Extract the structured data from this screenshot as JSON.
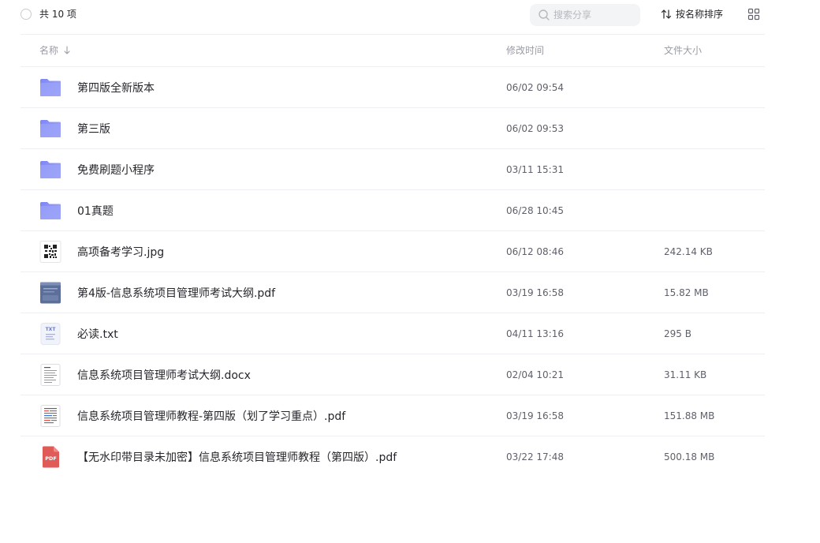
{
  "toolbar": {
    "total_label": "共 10 项",
    "search_placeholder": "搜索分享",
    "sort_label": "按名称排序"
  },
  "header": {
    "name": "名称",
    "modified": "修改时间",
    "size": "文件大小"
  },
  "files": [
    {
      "name": "第四版全新版本",
      "modified": "06/02 09:54",
      "size": "",
      "icon": "folder-icon"
    },
    {
      "name": "第三版",
      "modified": "06/02 09:53",
      "size": "",
      "icon": "folder-icon"
    },
    {
      "name": "免费刷题小程序",
      "modified": "03/11 15:31",
      "size": "",
      "icon": "folder-icon"
    },
    {
      "name": "01真题",
      "modified": "06/28 10:45",
      "size": "",
      "icon": "folder-icon"
    },
    {
      "name": "高项备考学习.jpg",
      "modified": "06/12 08:46",
      "size": "242.14 KB",
      "icon": "qr-image-thumbnail-icon"
    },
    {
      "name": "第4版-信息系统项目管理师考试大纲.pdf",
      "modified": "03/19 16:58",
      "size": "15.82 MB",
      "icon": "pdf-cover-thumbnail-icon"
    },
    {
      "name": "必读.txt",
      "modified": "04/11 13:16",
      "size": "295 B",
      "icon": "txt-file-icon",
      "icon_text": "TXT"
    },
    {
      "name": "信息系统项目管理师考试大纲.docx",
      "modified": "02/04 10:21",
      "size": "31.11 KB",
      "icon": "docx-thumbnail-icon"
    },
    {
      "name": "信息系统项目管理师教程-第四版（划了学习重点）.pdf",
      "modified": "03/19 16:58",
      "size": "151.88 MB",
      "icon": "pdf-page-thumbnail-icon"
    },
    {
      "name": "【无水印带目录未加密】信息系统项目管理师教程（第四版）.pdf",
      "modified": "03/22 17:48",
      "size": "500.18 MB",
      "icon": "pdf-file-icon",
      "icon_text": "PDF"
    }
  ],
  "colors": {
    "folder": "#8a93f5",
    "pdf": "#e05a58",
    "text": "#25262b",
    "muted": "#9a9ca5",
    "divider": "#eeeff2"
  }
}
